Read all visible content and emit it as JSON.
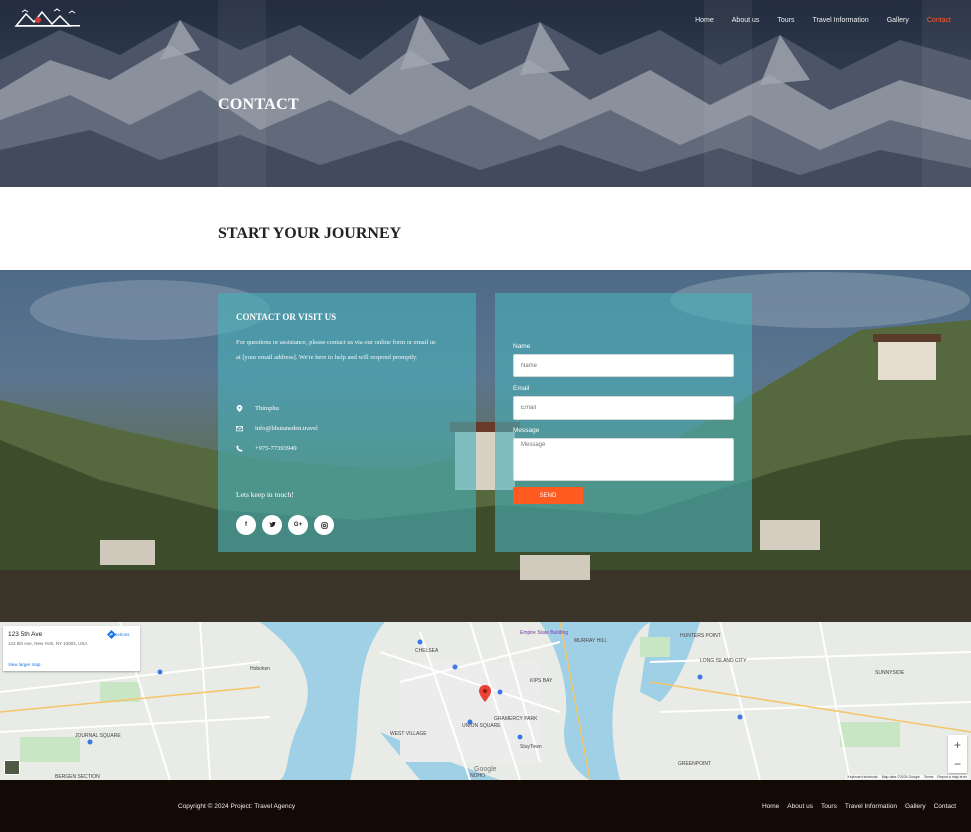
{
  "nav": {
    "items": [
      "Home",
      "About us",
      "Tours",
      "Travel Information",
      "Gallery",
      "Contact"
    ],
    "active": "Contact",
    "active_color": "#ff5a2a"
  },
  "hero": {
    "title": "CONTACT"
  },
  "section": {
    "heading": "START YOUR JOURNEY"
  },
  "contact_info": {
    "title": "CONTACT OR VISIT US",
    "text": "For questions or assistance, please contact us via our online form or email us at [your email address]. We're here to help and will respond promptly.",
    "location": "Thimphu",
    "email": "info@bhutaneden.travel",
    "phone": "+975-77393949",
    "keep_in_touch": "Lets keep in touch!",
    "socials": [
      "facebook-icon",
      "twitter-icon",
      "google-plus-icon",
      "instagram-icon"
    ]
  },
  "form": {
    "name_label": "Name",
    "name_placeholder": "Name",
    "email_label": "Email",
    "email_placeholder": "Email",
    "message_label": "Message",
    "message_placeholder": "Message",
    "send_label": "SEND",
    "send_color": "#ff5a1f"
  },
  "map": {
    "address_title": "123 5th Ave",
    "address_full": "123 5th Ave, New York, NY 10003, USA",
    "larger_map": "View larger map",
    "directions": "Directions",
    "labels": {
      "hoboken": "Hoboken",
      "chelsea": "CHELSEA",
      "murray_hill": "MURRAY HILL",
      "kips_bay": "KIPS BAY",
      "gramercy": "GRAMERCY PARK",
      "union_square": "UNION SQUARE",
      "west_village": "WEST VILLAGE",
      "empire": "Empire State Building",
      "journal_square": "JOURNAL SQUARE",
      "sunnyside": "SUNNYSIDE",
      "long_island_city": "LONG ISLAND CITY",
      "hunters_point": "HUNTERS POINT",
      "greenpoint": "GREENPOINT",
      "bergen": "BERGEN SECTION",
      "noho": "NOHO",
      "stuytown": "StuyTown"
    },
    "google": "Google",
    "footer": [
      "Keyboard shortcuts",
      "Map data ©2024 Google",
      "Terms",
      "Report a map error"
    ]
  },
  "footer": {
    "copyright": "Copyright © 2024 Project: Travel Agency",
    "links": [
      "Home",
      "About us",
      "Tours",
      "Travel Information",
      "Gallery",
      "Contact"
    ]
  }
}
